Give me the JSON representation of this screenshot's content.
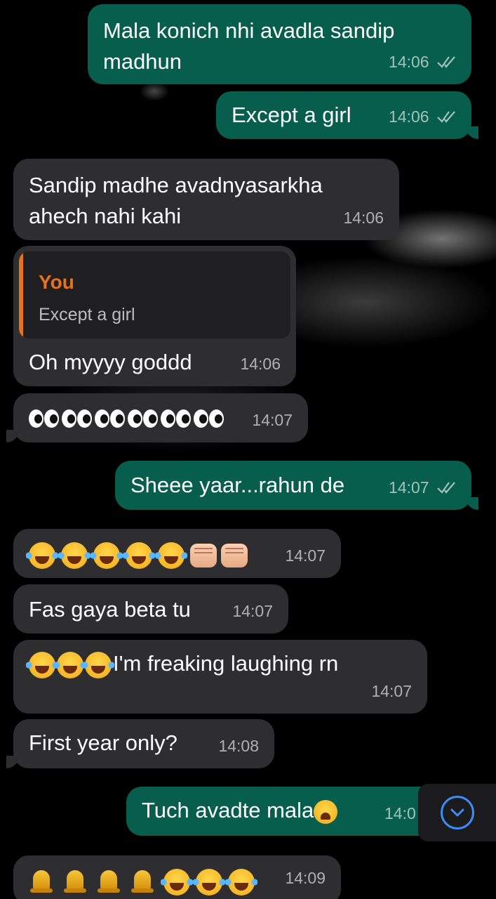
{
  "messages": [
    {
      "id": "m1",
      "direction": "out",
      "text_line1": "Mala konich nhi avadla sandip",
      "text_line2": "madhun",
      "time": "14:06",
      "read": true
    },
    {
      "id": "m2",
      "direction": "out",
      "text": "Except a girl",
      "time": "14:06",
      "read": true
    },
    {
      "id": "m3",
      "direction": "in",
      "text_line1": "Sandip madhe avadnyasarkha",
      "text_line2": "ahech nahi kahi",
      "time": "14:06"
    },
    {
      "id": "m4",
      "direction": "in",
      "reply_to": {
        "author": "You",
        "text": "Except a girl"
      },
      "text": "Oh myyyy goddd",
      "time": "14:06"
    },
    {
      "id": "m5",
      "direction": "in",
      "emoji": "👀👀👀👀👀👀",
      "time": "14:07"
    },
    {
      "id": "m6",
      "direction": "out",
      "text": "Sheee yaar...rahun de",
      "time": "14:07",
      "read": true
    },
    {
      "id": "m7",
      "direction": "in",
      "emoji": "😂😂😂😂😂👊🏻👊🏻",
      "time": "14:07"
    },
    {
      "id": "m8",
      "direction": "in",
      "text": "Fas gaya beta tu",
      "time": "14:07"
    },
    {
      "id": "m9",
      "direction": "in",
      "text": "I'm freaking laughing rn",
      "emoji_prefix": "😂😂😂",
      "time": "14:07"
    },
    {
      "id": "m10",
      "direction": "in",
      "text": "First year only?",
      "time": "14:08"
    },
    {
      "id": "m11",
      "direction": "out",
      "text": "Tuch avadte mala",
      "emoji_suffix": "😭",
      "time": "14:0",
      "read": true
    },
    {
      "id": "m12",
      "direction": "in",
      "emoji": "🔔🔔🔔🔔😂😂😂",
      "time": "14:09"
    }
  ],
  "scroll_button": {
    "icon": "chevron-down-icon"
  },
  "colors": {
    "background": "#000000",
    "outgoing_bubble": "#075e4c",
    "incoming_bubble": "#2e2e30",
    "reply_accent": "#e8711b",
    "scroll_accent": "#3d8cf5"
  }
}
